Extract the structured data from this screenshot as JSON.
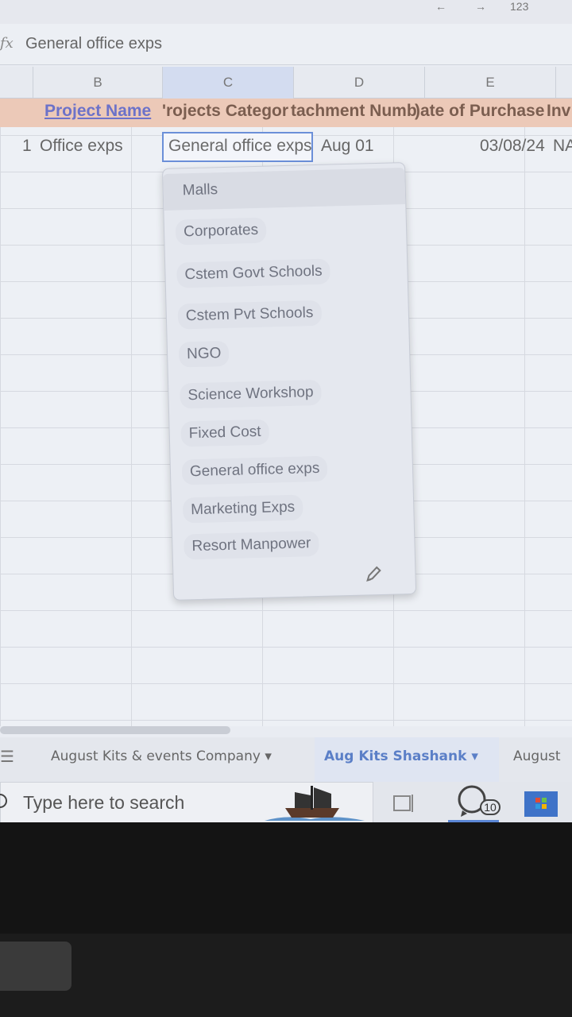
{
  "formula_bar": {
    "fx_label": "fx",
    "value": "General office exps"
  },
  "topstrip_glyph": "123",
  "columns": [
    "B",
    "C",
    "D",
    "E"
  ],
  "header_row": {
    "project_name": "Project Name",
    "projects_category": "'rojects Categor",
    "attachment_number": "tachment Numb",
    "date_of_purchase": ")ate of Purchase",
    "invoice": "Inv"
  },
  "data_row": {
    "row_number": "1",
    "project_name": "Office exps",
    "category": "General office exps",
    "attachment": "Aug 01",
    "date": "03/08/24",
    "invoice": "NA"
  },
  "dropdown": {
    "options": [
      "Malls",
      "Corporates",
      "Cstem Govt Schools",
      "Cstem Pvt Schools",
      "NGO",
      "Science Workshop",
      "Fixed Cost",
      "General office exps",
      "Marketing Exps",
      "Resort Manpower"
    ]
  },
  "sheet_tabs": {
    "tab1": "August Kits & events Company",
    "tab2": "Aug Kits Shashank",
    "tab3": "August"
  },
  "taskbar": {
    "search_placeholder": "Type here to search",
    "whatsapp_badge": "10"
  }
}
